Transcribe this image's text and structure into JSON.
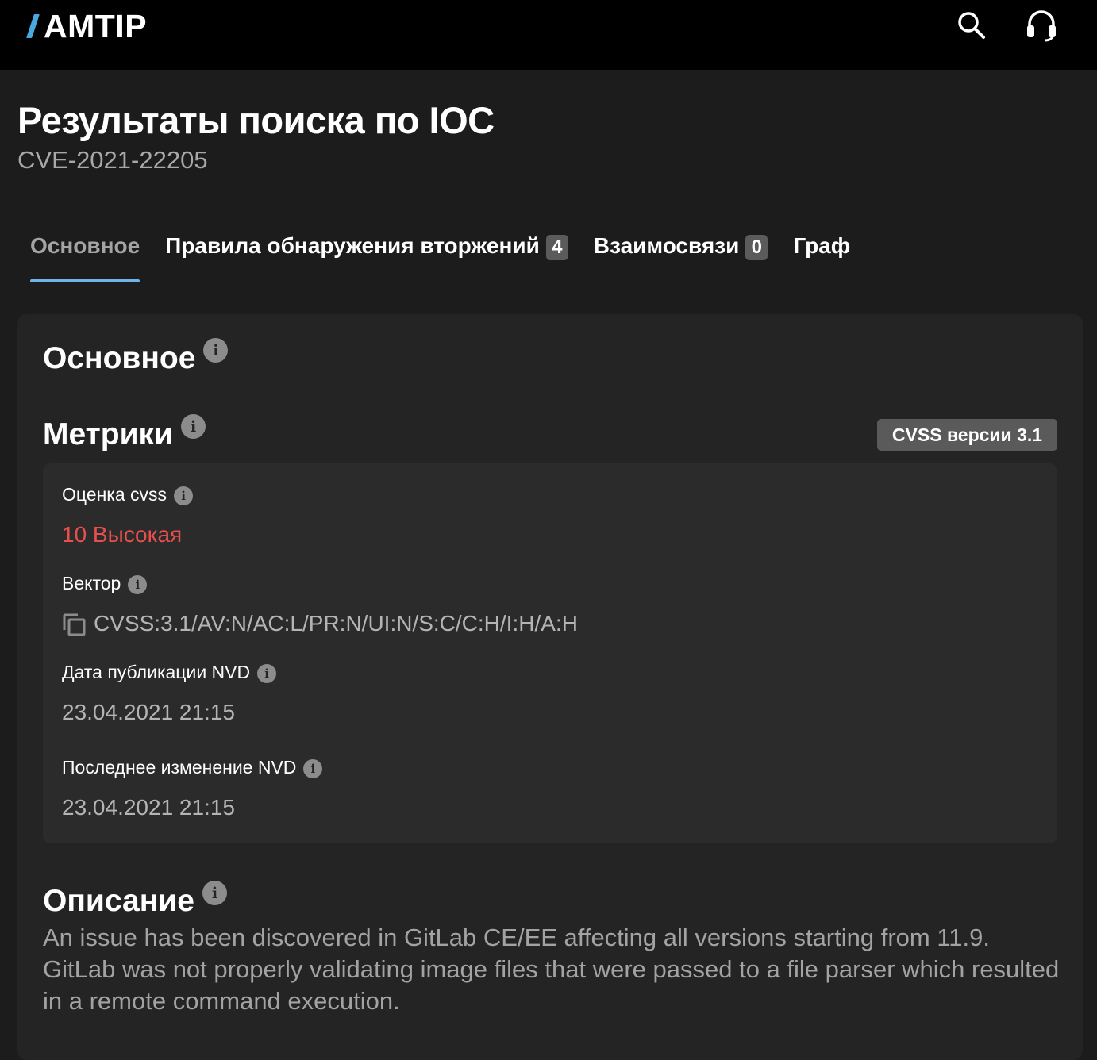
{
  "header": {
    "logo_text": "AMTIP",
    "icons": [
      "search-icon",
      "headset-icon"
    ],
    "accent_color": "#4aa8e0"
  },
  "page": {
    "title": "Результаты поиска по IOC",
    "subtitle": "CVE-2021-22205"
  },
  "tabs": [
    {
      "label": "Основное",
      "active": true
    },
    {
      "label": "Правила обнаружения вторжений",
      "count": "4"
    },
    {
      "label": "Взаимосвязи",
      "count": "0"
    },
    {
      "label": "Граф"
    }
  ],
  "main": {
    "heading": "Основное",
    "metrics": {
      "heading": "Метрики",
      "cvss_version_badge": "CVSS версии 3.1",
      "score_label": "Оценка cvss",
      "score_value": "10 Высокая",
      "score_color": "#e8504d",
      "vector_label": "Вектор",
      "vector_value": "CVSS:3.1/AV:N/AC:L/PR:N/UI:N/S:C/C:H/I:H/A:H",
      "published_label": "Дата публикации NVD",
      "published_value": "23.04.2021 21:15",
      "modified_label": "Последнее изменение NVD",
      "modified_value": "23.04.2021 21:15"
    },
    "description": {
      "heading": "Описание",
      "text": "An issue has been discovered in GitLab CE/EE affecting all versions starting from 11.9. GitLab was not properly validating image files that were passed to a file parser which resulted in a remote command execution."
    }
  }
}
